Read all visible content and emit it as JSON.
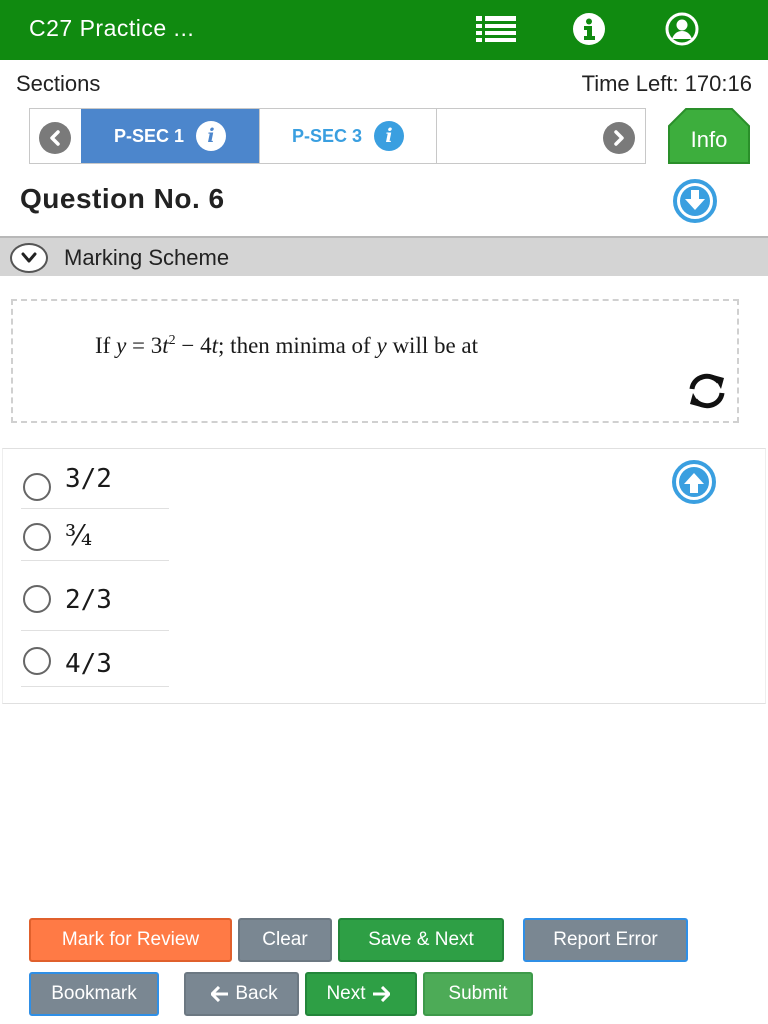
{
  "header": {
    "title": "C27 Practice ...",
    "icons": [
      "list-icon",
      "info-icon",
      "user-icon"
    ]
  },
  "sections": {
    "label": "Sections",
    "time_left": "Time Left: 170:16",
    "tabs": [
      {
        "label": "P-SEC 1",
        "active": true
      },
      {
        "label": "P-SEC 3",
        "active": false
      }
    ],
    "info_button": "Info"
  },
  "question": {
    "title": "Question No. 6",
    "marking_scheme": "Marking Scheme",
    "text_parts": {
      "prefix": "If ",
      "var_y": "y",
      "eq": " = 3",
      "var_t": "t",
      "exp": "2",
      "minus": " − 4",
      "var_t2": "t",
      "mid": "; then minima of ",
      "var_y2": "y",
      "suffix": " will be at"
    }
  },
  "options": [
    {
      "text": "3/2"
    },
    {
      "text": "¾"
    },
    {
      "text": "2/3"
    },
    {
      "text": "4/3"
    }
  ],
  "buttons": {
    "mark_for_review": "Mark for Review",
    "clear": "Clear",
    "save_next": "Save & Next",
    "report_error": "Report Error",
    "bookmark": "Bookmark",
    "back": "Back",
    "next": "Next",
    "submit": "Submit"
  },
  "colors": {
    "header_bg": "#108a10",
    "active_tab": "#4c86cc",
    "accent_blue": "#3a9fe0",
    "orange": "#ff7a45",
    "gray": "#7a8792",
    "green": "#2e9f45"
  }
}
